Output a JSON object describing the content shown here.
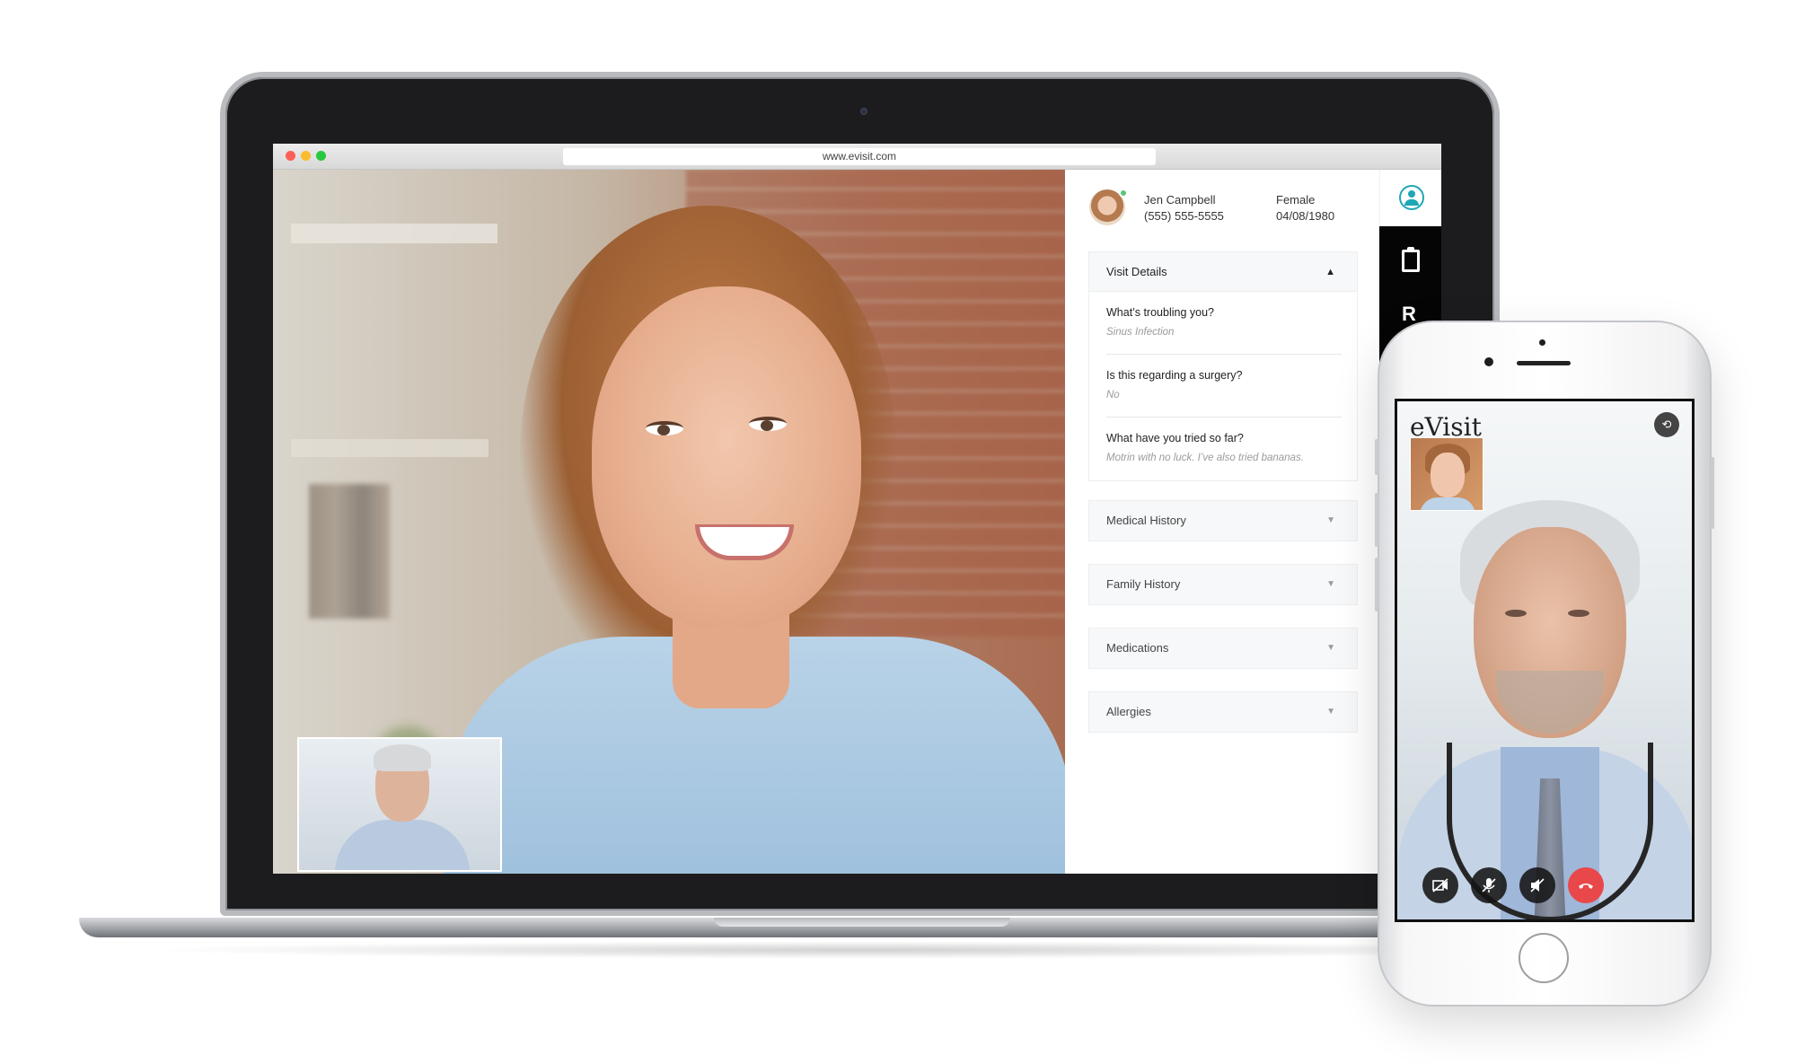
{
  "browser": {
    "url": "www.evisit.com"
  },
  "patient": {
    "name": "Jen Campbell",
    "phone": "(555) 555-5555",
    "gender": "Female",
    "dob": "04/08/1980"
  },
  "visit_details": {
    "title": "Visit Details",
    "expanded": true,
    "items": [
      {
        "question": "What’s troubling you?",
        "answer": "Sinus Infection"
      },
      {
        "question": "Is this regarding a surgery?",
        "answer": "No"
      },
      {
        "question": "What have you tried so far?",
        "answer": "Motrin with no luck. I’ve also tried bananas."
      }
    ]
  },
  "sections": [
    {
      "label": "Medical History",
      "expanded": false
    },
    {
      "label": "Family History",
      "expanded": false
    },
    {
      "label": "Medications",
      "expanded": false
    },
    {
      "label": "Allergies",
      "expanded": false
    }
  ],
  "side_nav": {
    "items": [
      "user-icon",
      "clipboard-icon",
      "prescription-icon"
    ],
    "accent": "#1fa7b4"
  },
  "phone_app": {
    "logo": "eVisit",
    "call_controls": [
      "video-off-icon",
      "mic-off-icon",
      "speaker-off-icon",
      "hang-up-icon"
    ],
    "hangup_color": "#e8484a"
  }
}
